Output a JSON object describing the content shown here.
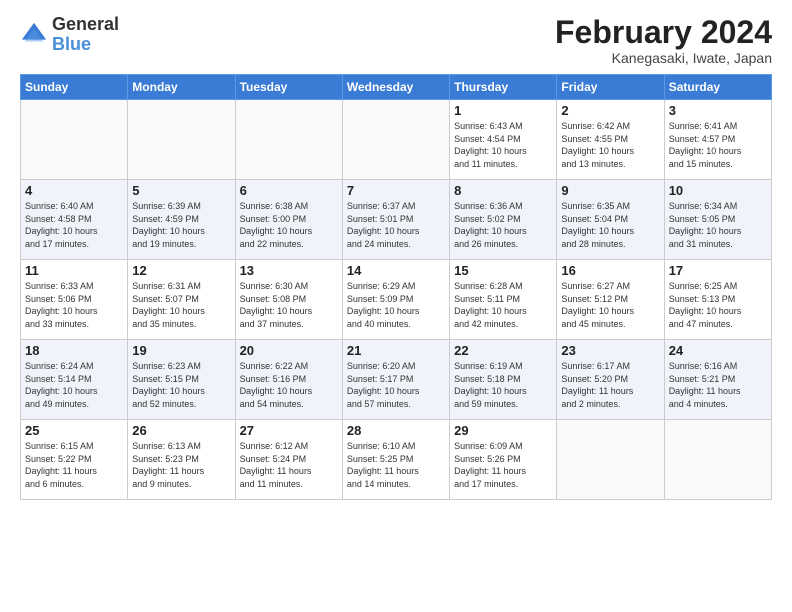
{
  "logo": {
    "general": "General",
    "blue": "Blue"
  },
  "title": "February 2024",
  "location": "Kanegasaki, Iwate, Japan",
  "days_of_week": [
    "Sunday",
    "Monday",
    "Tuesday",
    "Wednesday",
    "Thursday",
    "Friday",
    "Saturday"
  ],
  "weeks": [
    [
      {
        "num": "",
        "info": ""
      },
      {
        "num": "",
        "info": ""
      },
      {
        "num": "",
        "info": ""
      },
      {
        "num": "",
        "info": ""
      },
      {
        "num": "1",
        "info": "Sunrise: 6:43 AM\nSunset: 4:54 PM\nDaylight: 10 hours\nand 11 minutes."
      },
      {
        "num": "2",
        "info": "Sunrise: 6:42 AM\nSunset: 4:55 PM\nDaylight: 10 hours\nand 13 minutes."
      },
      {
        "num": "3",
        "info": "Sunrise: 6:41 AM\nSunset: 4:57 PM\nDaylight: 10 hours\nand 15 minutes."
      }
    ],
    [
      {
        "num": "4",
        "info": "Sunrise: 6:40 AM\nSunset: 4:58 PM\nDaylight: 10 hours\nand 17 minutes."
      },
      {
        "num": "5",
        "info": "Sunrise: 6:39 AM\nSunset: 4:59 PM\nDaylight: 10 hours\nand 19 minutes."
      },
      {
        "num": "6",
        "info": "Sunrise: 6:38 AM\nSunset: 5:00 PM\nDaylight: 10 hours\nand 22 minutes."
      },
      {
        "num": "7",
        "info": "Sunrise: 6:37 AM\nSunset: 5:01 PM\nDaylight: 10 hours\nand 24 minutes."
      },
      {
        "num": "8",
        "info": "Sunrise: 6:36 AM\nSunset: 5:02 PM\nDaylight: 10 hours\nand 26 minutes."
      },
      {
        "num": "9",
        "info": "Sunrise: 6:35 AM\nSunset: 5:04 PM\nDaylight: 10 hours\nand 28 minutes."
      },
      {
        "num": "10",
        "info": "Sunrise: 6:34 AM\nSunset: 5:05 PM\nDaylight: 10 hours\nand 31 minutes."
      }
    ],
    [
      {
        "num": "11",
        "info": "Sunrise: 6:33 AM\nSunset: 5:06 PM\nDaylight: 10 hours\nand 33 minutes."
      },
      {
        "num": "12",
        "info": "Sunrise: 6:31 AM\nSunset: 5:07 PM\nDaylight: 10 hours\nand 35 minutes."
      },
      {
        "num": "13",
        "info": "Sunrise: 6:30 AM\nSunset: 5:08 PM\nDaylight: 10 hours\nand 37 minutes."
      },
      {
        "num": "14",
        "info": "Sunrise: 6:29 AM\nSunset: 5:09 PM\nDaylight: 10 hours\nand 40 minutes."
      },
      {
        "num": "15",
        "info": "Sunrise: 6:28 AM\nSunset: 5:11 PM\nDaylight: 10 hours\nand 42 minutes."
      },
      {
        "num": "16",
        "info": "Sunrise: 6:27 AM\nSunset: 5:12 PM\nDaylight: 10 hours\nand 45 minutes."
      },
      {
        "num": "17",
        "info": "Sunrise: 6:25 AM\nSunset: 5:13 PM\nDaylight: 10 hours\nand 47 minutes."
      }
    ],
    [
      {
        "num": "18",
        "info": "Sunrise: 6:24 AM\nSunset: 5:14 PM\nDaylight: 10 hours\nand 49 minutes."
      },
      {
        "num": "19",
        "info": "Sunrise: 6:23 AM\nSunset: 5:15 PM\nDaylight: 10 hours\nand 52 minutes."
      },
      {
        "num": "20",
        "info": "Sunrise: 6:22 AM\nSunset: 5:16 PM\nDaylight: 10 hours\nand 54 minutes."
      },
      {
        "num": "21",
        "info": "Sunrise: 6:20 AM\nSunset: 5:17 PM\nDaylight: 10 hours\nand 57 minutes."
      },
      {
        "num": "22",
        "info": "Sunrise: 6:19 AM\nSunset: 5:18 PM\nDaylight: 10 hours\nand 59 minutes."
      },
      {
        "num": "23",
        "info": "Sunrise: 6:17 AM\nSunset: 5:20 PM\nDaylight: 11 hours\nand 2 minutes."
      },
      {
        "num": "24",
        "info": "Sunrise: 6:16 AM\nSunset: 5:21 PM\nDaylight: 11 hours\nand 4 minutes."
      }
    ],
    [
      {
        "num": "25",
        "info": "Sunrise: 6:15 AM\nSunset: 5:22 PM\nDaylight: 11 hours\nand 6 minutes."
      },
      {
        "num": "26",
        "info": "Sunrise: 6:13 AM\nSunset: 5:23 PM\nDaylight: 11 hours\nand 9 minutes."
      },
      {
        "num": "27",
        "info": "Sunrise: 6:12 AM\nSunset: 5:24 PM\nDaylight: 11 hours\nand 11 minutes."
      },
      {
        "num": "28",
        "info": "Sunrise: 6:10 AM\nSunset: 5:25 PM\nDaylight: 11 hours\nand 14 minutes."
      },
      {
        "num": "29",
        "info": "Sunrise: 6:09 AM\nSunset: 5:26 PM\nDaylight: 11 hours\nand 17 minutes."
      },
      {
        "num": "",
        "info": ""
      },
      {
        "num": "",
        "info": ""
      }
    ]
  ]
}
